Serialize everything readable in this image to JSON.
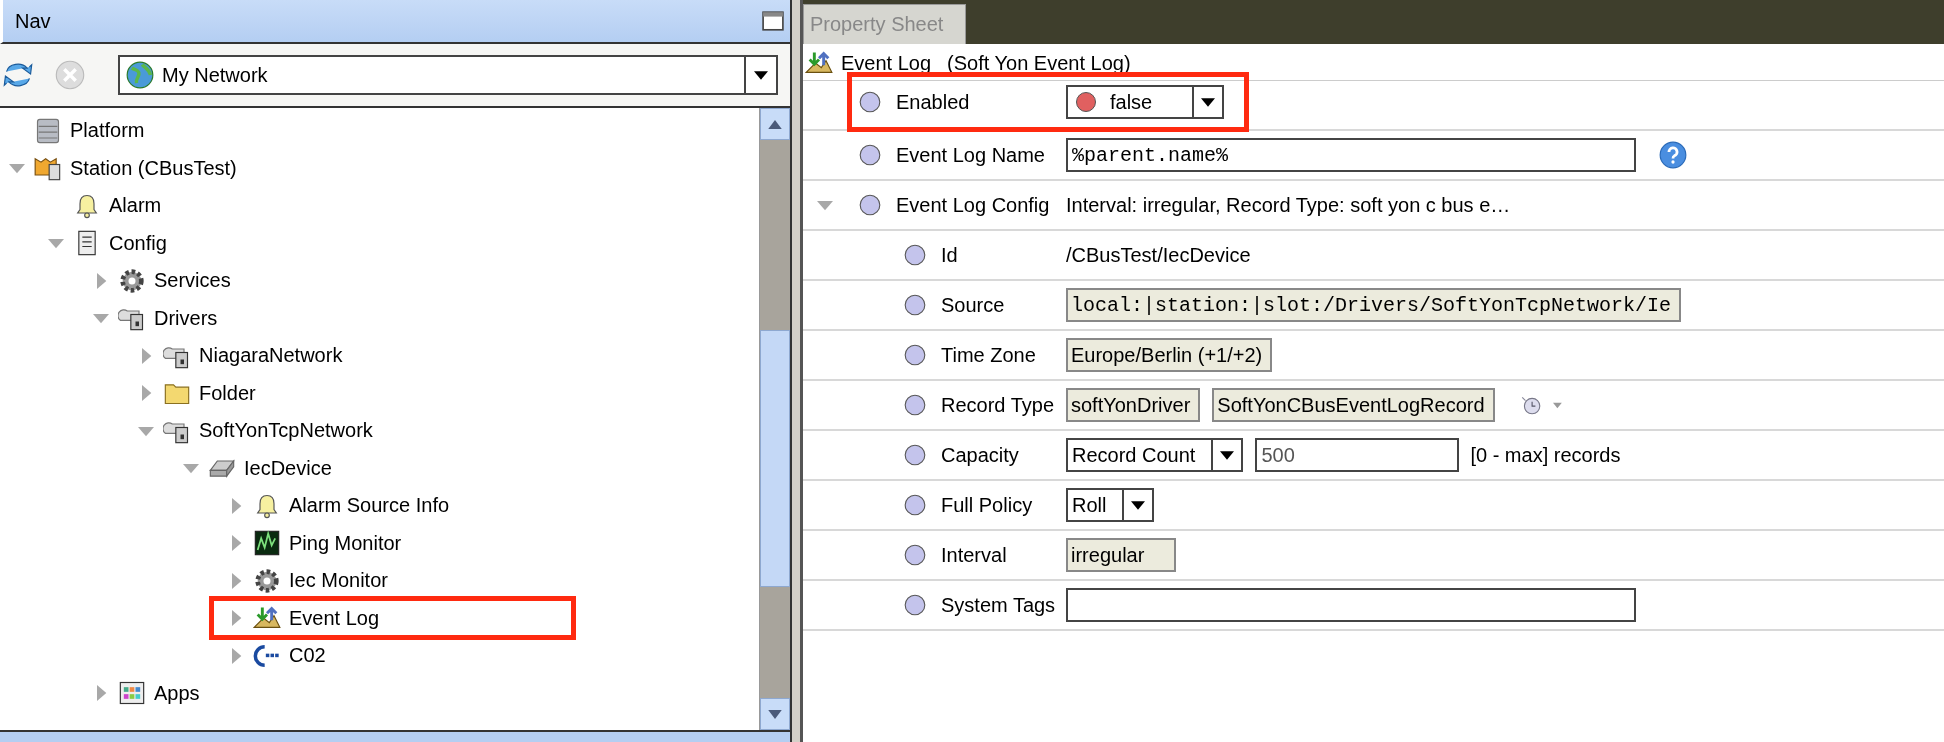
{
  "nav": {
    "title": "Nav",
    "location": "My Network",
    "tree": [
      {
        "label": "Platform",
        "kind": "platform",
        "highlighted": false
      },
      {
        "label": "Station (CBusTest)",
        "kind": "station",
        "expanded": true,
        "highlighted": false,
        "children": [
          {
            "label": "Alarm",
            "kind": "bell",
            "highlighted": false
          },
          {
            "label": "Config",
            "kind": "config",
            "expanded": true,
            "highlighted": false,
            "children": [
              {
                "label": "Services",
                "kind": "gear",
                "expanded": false,
                "highlighted": false
              },
              {
                "label": "Drivers",
                "kind": "network",
                "expanded": true,
                "highlighted": false,
                "children": [
                  {
                    "label": "NiagaraNetwork",
                    "kind": "network",
                    "expanded": false,
                    "highlighted": false
                  },
                  {
                    "label": "Folder",
                    "kind": "folder",
                    "expanded": false,
                    "highlighted": false
                  },
                  {
                    "label": "SoftYonTcpNetwork",
                    "kind": "network",
                    "expanded": true,
                    "highlighted": false,
                    "children": [
                      {
                        "label": "IecDevice",
                        "kind": "device",
                        "expanded": true,
                        "highlighted": false,
                        "children": [
                          {
                            "label": "Alarm Source Info",
                            "kind": "bell",
                            "expanded": false,
                            "highlighted": false
                          },
                          {
                            "label": "Ping Monitor",
                            "kind": "monitor",
                            "expanded": false,
                            "highlighted": false
                          },
                          {
                            "label": "Iec Monitor",
                            "kind": "gear",
                            "expanded": false,
                            "highlighted": false
                          },
                          {
                            "label": "Event Log",
                            "kind": "eventlog",
                            "expanded": false,
                            "highlighted": true
                          },
                          {
                            "label": "C02",
                            "kind": "point",
                            "expanded": false,
                            "highlighted": false
                          }
                        ]
                      }
                    ]
                  }
                ]
              },
              {
                "label": "Apps",
                "kind": "apps",
                "expanded": false,
                "highlighted": false
              }
            ]
          }
        ]
      }
    ]
  },
  "property_sheet": {
    "tab": "Property Sheet",
    "title": "Event Log",
    "type": "(Soft Yon Event Log)",
    "properties": [
      {
        "label": "Enabled",
        "highlighted": true,
        "fields": [
          {
            "kind": "select",
            "value": "false",
            "color": "#e06060"
          }
        ]
      },
      {
        "label": "Event Log Name",
        "highlighted": false,
        "help": true,
        "fields": [
          {
            "kind": "mono-text",
            "value": "%parent.name%"
          }
        ]
      },
      {
        "label": "Event Log Config",
        "highlighted": false,
        "expanded": true,
        "summary": "Interval: irregular, Record Type: soft yon c bus e…",
        "children": [
          {
            "label": "Id",
            "highlighted": false,
            "fields": [
              {
                "kind": "label",
                "value": "/CBusTest/IecDevice"
              }
            ]
          },
          {
            "label": "Source",
            "highlighted": false,
            "fields": [
              {
                "kind": "mono-readonly",
                "value": "local:|station:|slot:/Drivers/SoftYonTcpNetwork/Ie"
              }
            ]
          },
          {
            "label": "Time Zone",
            "highlighted": false,
            "fields": [
              {
                "kind": "readonly",
                "value": "Europe/Berlin (+1/+2)"
              }
            ]
          },
          {
            "label": "Record Type",
            "highlighted": false,
            "history": true,
            "fields": [
              {
                "kind": "readonly",
                "value": "softYonDriver"
              },
              {
                "kind": "readonly",
                "value": "SoftYonCBusEventLogRecord"
              }
            ]
          },
          {
            "label": "Capacity",
            "highlighted": false,
            "suffix": "[0 - max] records",
            "fields": [
              {
                "kind": "select",
                "value": "Record Count"
              },
              {
                "kind": "text",
                "value": "500"
              }
            ]
          },
          {
            "label": "Full Policy",
            "highlighted": false,
            "fields": [
              {
                "kind": "select",
                "value": "Roll"
              }
            ]
          },
          {
            "label": "Interval",
            "highlighted": false,
            "fields": [
              {
                "kind": "readonly",
                "value": "irregular"
              }
            ]
          },
          {
            "label": "System Tags",
            "highlighted": false,
            "fields": [
              {
                "kind": "text"
              }
            ]
          }
        ]
      }
    ]
  }
}
